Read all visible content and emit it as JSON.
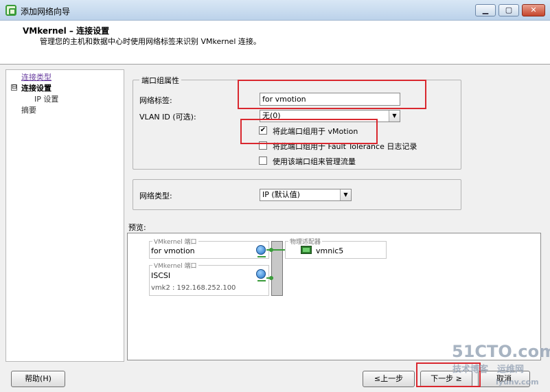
{
  "window": {
    "title": "添加网络向导",
    "minimize_glyph": "▁",
    "maximize_glyph": "▢",
    "close_glyph": "✕"
  },
  "header": {
    "title": "VMkernel – 连接设置",
    "description": "管理您的主机和数据中心时使用网络标签来识别 VMkernel 连接。"
  },
  "nav": {
    "toggle": "⊟",
    "items": [
      {
        "label": "连接类型"
      },
      {
        "label": "连接设置"
      },
      {
        "label": "IP 设置"
      },
      {
        "label": "摘要"
      }
    ]
  },
  "port_group": {
    "legend": "端口组属性",
    "network_label_label": "网络标签:",
    "network_label_value": "for vmotion",
    "vlan_label": "VLAN ID (可选):",
    "vlan_value": "无(0)",
    "checkboxes": [
      {
        "label": "将此端口组用于 vMotion",
        "checked": true
      },
      {
        "label": "将此端口组用于 Fault Tolerance 日志记录",
        "checked": false
      },
      {
        "label": "使用该端口组来管理流量",
        "checked": false
      }
    ],
    "check_glyph": "✔"
  },
  "network_type": {
    "label": "网络类型:",
    "value": "IP (默认值)"
  },
  "preview": {
    "label": "预览:",
    "ports": [
      {
        "legend": "VMkernel 端口",
        "name": "for vmotion"
      },
      {
        "legend": "VMkernel 端口",
        "name": "ISCSI",
        "detail": "vmk2 : 192.168.252.100"
      }
    ],
    "adapter": {
      "legend": "物理适配器",
      "name": "vmnic5"
    }
  },
  "buttons": {
    "help": "帮助(H)",
    "back": "≤上一步",
    "next": "下一步 ≥",
    "cancel": "取消"
  },
  "watermark": {
    "line1": "51CTO.com",
    "line2": "技术博客",
    "line3": "运维网",
    "line4": "iyunv.com"
  },
  "colors": {
    "highlight": "#d9272e",
    "link": "#6a3fa0",
    "status_green": "#3a9b3a"
  },
  "dropdown_arrow": "▼"
}
